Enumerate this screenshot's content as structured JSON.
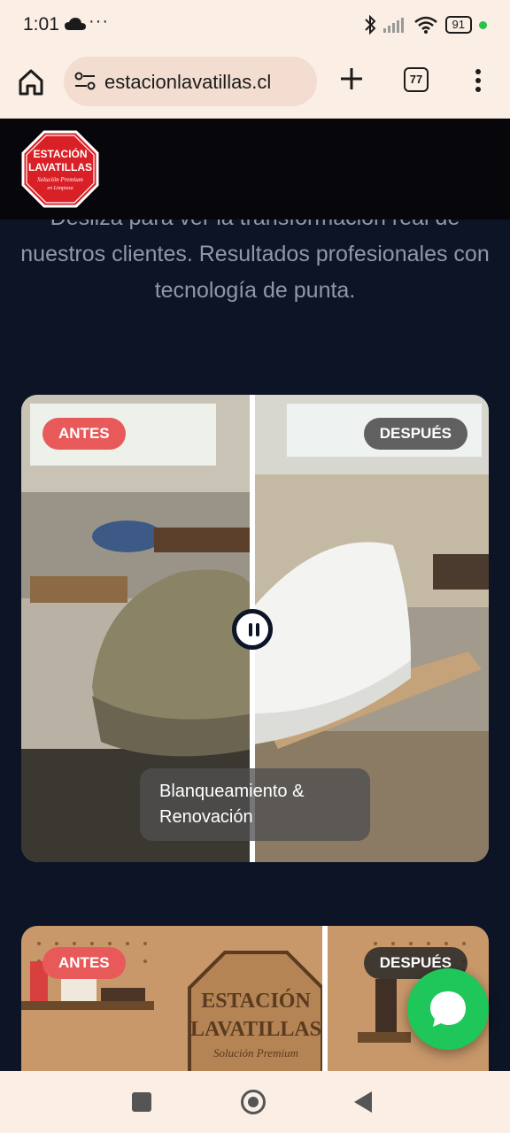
{
  "status_bar": {
    "time": "1:01",
    "dots": "···",
    "battery": "91"
  },
  "browser": {
    "url": "estacionlavatillas.cl",
    "tab_count": "77"
  },
  "logo": {
    "line1": "ESTACIÓN",
    "line2": "LAVATILLAS",
    "line3": "Solución Premium",
    "line4": "en Limpieza"
  },
  "intro": {
    "text": "Desliza para ver la transformación real de nuestros clientes. Resultados profesionales con tecnología de punta."
  },
  "card1": {
    "before_label": "ANTES",
    "after_label": "DESPUÉS",
    "caption": "Blanqueamiento & Renovación"
  },
  "card2": {
    "before_label": "ANTES",
    "after_label": "DESPUÉS",
    "sign_line1": "ESTACIÓN",
    "sign_line2": "LAVATILLAS",
    "sign_line3": "Solución Premium"
  },
  "colors": {
    "page_bg": "#0c1426",
    "antes": "#e85a5a",
    "whatsapp": "#1fc75a"
  }
}
